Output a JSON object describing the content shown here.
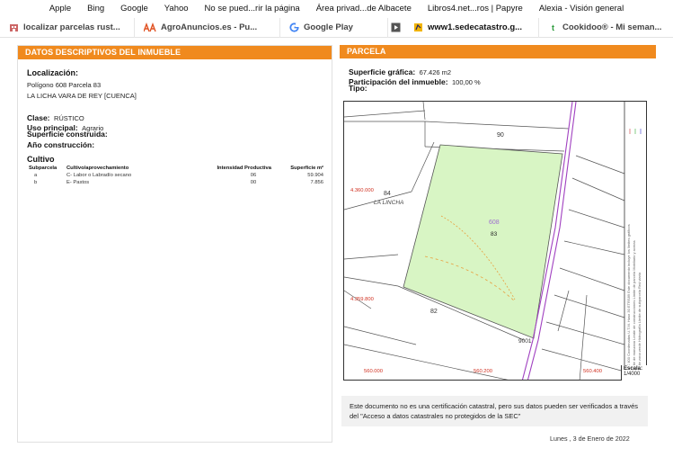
{
  "favorites": [
    "Apple",
    "Bing",
    "Google",
    "Yahoo",
    "No se pued...rir la página",
    "Área privad...de Albacete",
    "Libros4.net...ros | Papyre",
    "Alexia - Visión general"
  ],
  "bookmarks": [
    {
      "icon": "building-icon",
      "label": "localizar parcelas rust..."
    },
    {
      "icon": "agroanuncios-icon",
      "label": "AgroAnuncios.es - Pu..."
    },
    {
      "icon": "google-icon",
      "label": "Google Play"
    },
    {
      "icon": "play-icon",
      "label": ""
    },
    {
      "icon": "catastro-icon",
      "label": "www1.sedecatastro.g..."
    },
    {
      "icon": "cookidoo-icon",
      "label": "Cookidoo® - Mi seman..."
    }
  ],
  "left_panel": {
    "title": "DATOS DESCRIPTIVOS DEL INMUEBLE",
    "localizacion_label": "Localización:",
    "address_line1": "Polígono 608 Parcela 83",
    "address_line2": "LA LICHA  VARA DE REY [CUENCA]",
    "clase_label": "Clase:",
    "clase_value": "RÚSTICO",
    "uso_label": "Uso principal:",
    "uso_value": "Agrario",
    "sup_label": "Superficie construida:",
    "anio_label": "Año construcción:",
    "cultivo_label": "Cultivo",
    "table_headers": [
      "Subparcela",
      "Cultivo/aprovechamiento",
      "Intensidad Productiva",
      "Superficie m²"
    ],
    "table_rows": [
      [
        "a",
        "C- Labor o Labradío secano",
        "06",
        "59.904"
      ],
      [
        "b",
        "E- Pastos",
        "00",
        "7.856"
      ]
    ]
  },
  "right_panel": {
    "title": "PARCELA",
    "sup_grafica_label": "Superficie gráfica:",
    "sup_grafica_value": "67.426 m2",
    "participacion_label": "Participación del inmueble:",
    "participacion_value": "100,00 %",
    "tipo_label": "Tipo:",
    "map_labels": {
      "p90": "90",
      "p84": "84",
      "paraje": "LA LINCHA",
      "poligono": "608",
      "parcela": "83",
      "p82": "82",
      "p9001": "9001",
      "coord_y1": "4.360.000",
      "coord_y2": "4.359.800",
      "coord_x1": "560.000",
      "coord_x2": "560.200",
      "coord_x3": "560.400"
    },
    "scale_label": "Escala:",
    "scale_value": "1/4000",
    "notice": "Este documento no es una certificación catastral, pero sus datos pueden ser verificados a través del \"Acceso a datos catastrales no protegidos de la SEC\"",
    "date": "Lunes , 3 de Enero de 2022"
  },
  "colors": {
    "header_orange": "#f08a1e",
    "parcel_fill": "#d8f5c4",
    "boundary_purple": "#a040c0",
    "coord_red": "#d03020"
  }
}
